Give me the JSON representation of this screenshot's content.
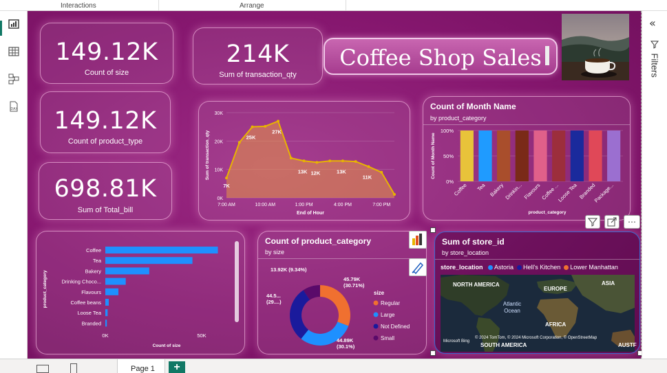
{
  "ribbon": {
    "interactions": "Interactions",
    "arrange": "Arrange"
  },
  "kpis": [
    {
      "value": "149.12K",
      "label": "Count of size"
    },
    {
      "value": "214K",
      "label": "Sum of transaction_qty"
    },
    {
      "value": "149.12K",
      "label": "Count of product_type"
    },
    {
      "value": "698.81K",
      "label": "Sum of Total_bill"
    }
  ],
  "title": "Coffee Shop Sales",
  "line_chart": {
    "chart_data": {
      "type": "area",
      "x": [
        7,
        8,
        9,
        10,
        11,
        12,
        13,
        14,
        15,
        16,
        17,
        18,
        19,
        20
      ],
      "values": [
        7000,
        19500,
        25000,
        25200,
        27000,
        14000,
        13000,
        12500,
        13000,
        13000,
        12800,
        11000,
        9000,
        1200
      ],
      "data_labels": [
        {
          "text": "7K",
          "i": 0
        },
        {
          "text": "25K",
          "i": 2
        },
        {
          "text": "27K",
          "i": 4
        },
        {
          "text": "13K",
          "i": 6
        },
        {
          "text": "12K",
          "i": 7
        },
        {
          "text": "13K",
          "i": 9
        },
        {
          "text": "11K",
          "i": 11
        }
      ],
      "xticks": [
        {
          "v": 7,
          "label": "7:00 AM"
        },
        {
          "v": 10,
          "label": "10:00 AM"
        },
        {
          "v": 13,
          "label": "1:00 PM"
        },
        {
          "v": 16,
          "label": "4:00 PM"
        },
        {
          "v": 19,
          "label": "7:00 PM"
        }
      ],
      "yticks": [
        {
          "v": 0,
          "label": "0K"
        },
        {
          "v": 10000,
          "label": "10K"
        },
        {
          "v": 20000,
          "label": "20K"
        },
        {
          "v": 30000,
          "label": "30K"
        }
      ],
      "ylim": [
        0,
        30000
      ],
      "xlim": [
        7,
        20
      ],
      "xlabel": "End of Hour",
      "ylabel": "Sum of transaction_qty",
      "color": "#e8b400"
    }
  },
  "month_chart": {
    "title": "Count of Month Name",
    "subtitle": "by product_category",
    "chart_data": {
      "type": "bar",
      "categories": [
        "Coffee",
        "Tea",
        "Bakery",
        "Drinkin...",
        "Flavours",
        "Coffee ...",
        "Loose Tea",
        "Branded",
        "Package..."
      ],
      "values": [
        100,
        100,
        100,
        100,
        100,
        100,
        100,
        100,
        100
      ],
      "colors": [
        "#e8c33a",
        "#1f9bff",
        "#a94e2c",
        "#7a2a18",
        "#e0608a",
        "#9c2e3c",
        "#1a2a9c",
        "#e04858",
        "#9b6fd0"
      ],
      "yticks": [
        {
          "v": 0,
          "label": "0%"
        },
        {
          "v": 50,
          "label": "50%"
        },
        {
          "v": 100,
          "label": "100%"
        }
      ],
      "ylim": [
        0,
        100
      ],
      "xlabel": "product_category",
      "ylabel": "Count of Month Name"
    }
  },
  "hbar_chart": {
    "chart_data": {
      "type": "bar",
      "categories": [
        "Coffee",
        "Tea",
        "Bakery",
        "Drinking Choco...",
        "Flavours",
        "Coffee beans",
        "Loose Tea",
        "Branded"
      ],
      "values": [
        58400,
        45200,
        22800,
        10600,
        6800,
        1800,
        1200,
        800
      ],
      "xlim": [
        0,
        65000
      ],
      "xticks": [
        {
          "v": 0,
          "label": "0K"
        },
        {
          "v": 50000,
          "label": "50K"
        }
      ],
      "xlabel": "Count of size",
      "ylabel": "product_category",
      "color": "#1e90ff"
    }
  },
  "donut_chart": {
    "title": "Count of product_category",
    "subtitle": "by size",
    "legend_title": "size",
    "chart_data": {
      "type": "pie",
      "series": [
        {
          "name": "Regular",
          "value": 45790,
          "label": "45.79K",
          "pct": "(30.71%)",
          "color": "#f07030"
        },
        {
          "name": "Large",
          "value": 44890,
          "label": "44.89K",
          "pct": "(30.1%)",
          "color": "#1e90ff"
        },
        {
          "name": "Not Defined",
          "value": 44500,
          "label": "44.5...",
          "pct": "(29....)",
          "color": "#1a1a9c"
        },
        {
          "name": "Small",
          "value": 13920,
          "label": "13.92K (9.34%)",
          "pct": "",
          "color": "#5a0a6a"
        }
      ]
    }
  },
  "map": {
    "title": "Sum of store_id",
    "subtitle": "by store_location",
    "legend_title": "store_location",
    "legend": [
      {
        "name": "Astoria",
        "color": "#1e90ff"
      },
      {
        "name": "Hell's Kitchen",
        "color": "#1a1a9c"
      },
      {
        "name": "Lower Manhattan",
        "color": "#f07030"
      }
    ],
    "labels": {
      "na": "NORTH AMERICA",
      "eu": "EUROPE",
      "as": "ASIA",
      "ao": "Atlantic\nOcean",
      "af": "AFRICA",
      "sa": "SOUTH AMERICA",
      "aus": "AUSTF"
    },
    "copyright": "© 2024 TomTom, © 2024 Microsoft Corporation, © OpenStreetMap",
    "bing": "Microsoft Bing"
  },
  "right_pane": {
    "filters": "Filters",
    "collapse": "«"
  },
  "bottom": {
    "page": "Page 1",
    "add": "+"
  }
}
